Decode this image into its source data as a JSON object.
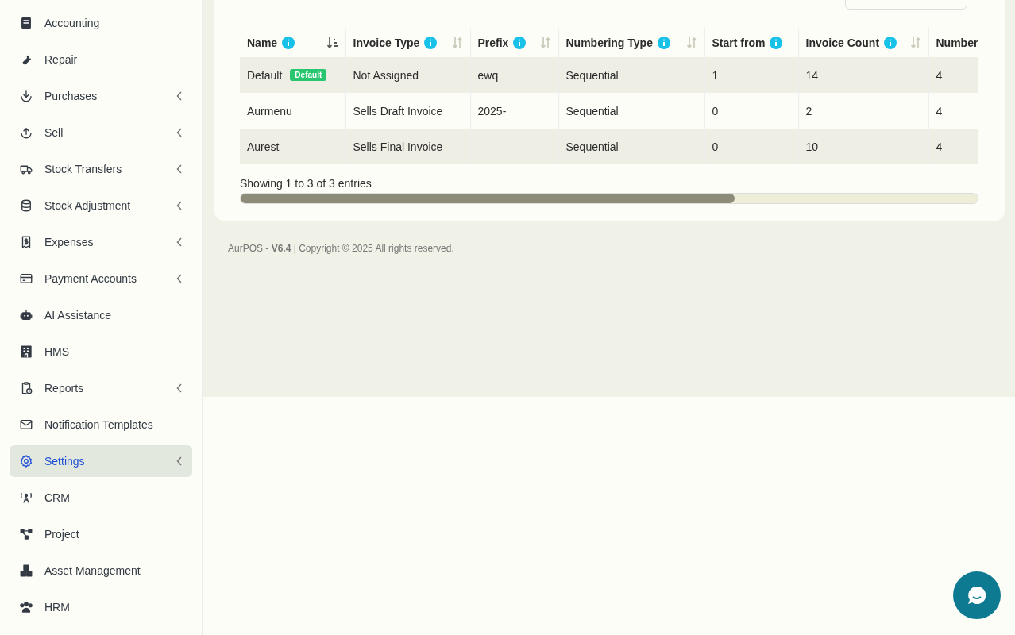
{
  "sidebar": {
    "items": [
      {
        "label": "Accounting",
        "submenu": false,
        "selected": false
      },
      {
        "label": "Repair",
        "submenu": false,
        "selected": false
      },
      {
        "label": "Purchases",
        "submenu": true,
        "selected": false
      },
      {
        "label": "Sell",
        "submenu": true,
        "selected": false
      },
      {
        "label": "Stock Transfers",
        "submenu": true,
        "selected": false
      },
      {
        "label": "Stock Adjustment",
        "submenu": true,
        "selected": false
      },
      {
        "label": "Expenses",
        "submenu": true,
        "selected": false
      },
      {
        "label": "Payment Accounts",
        "submenu": true,
        "selected": false
      },
      {
        "label": "AI Assistance",
        "submenu": false,
        "selected": false
      },
      {
        "label": "HMS",
        "submenu": false,
        "selected": false
      },
      {
        "label": "Reports",
        "submenu": true,
        "selected": false
      },
      {
        "label": "Notification Templates",
        "submenu": false,
        "selected": false
      },
      {
        "label": "Settings",
        "submenu": true,
        "selected": true
      },
      {
        "label": "CRM",
        "submenu": false,
        "selected": false
      },
      {
        "label": "Project",
        "submenu": false,
        "selected": false
      },
      {
        "label": "Asset Management",
        "submenu": false,
        "selected": false
      },
      {
        "label": "HRM",
        "submenu": false,
        "selected": false
      }
    ]
  },
  "table": {
    "columns": [
      {
        "label": "Name",
        "info": true,
        "sortable": true,
        "sorted": true
      },
      {
        "label": "Invoice Type",
        "info": true,
        "sortable": true,
        "sorted": false
      },
      {
        "label": "Prefix",
        "info": true,
        "sortable": true,
        "sorted": false
      },
      {
        "label": "Numbering Type",
        "info": true,
        "sortable": true,
        "sorted": false
      },
      {
        "label": "Start from",
        "info": true,
        "sortable": false
      },
      {
        "label": "Invoice Count",
        "info": true,
        "sortable": true,
        "sorted": false
      },
      {
        "label": "Number",
        "info": false,
        "sortable": false
      }
    ],
    "rows": [
      {
        "cells": [
          "Default",
          "Not Assigned",
          "ewq",
          "Sequential",
          "1",
          "14",
          "4"
        ],
        "badge": "Default"
      },
      {
        "cells": [
          "Aurmenu",
          "Sells Draft Invoice",
          "2025-",
          "Sequential",
          "0",
          "2",
          "4"
        ]
      },
      {
        "cells": [
          "Aurest",
          "Sells Final Invoice",
          "",
          "Sequential",
          "0",
          "10",
          "4"
        ]
      }
    ],
    "info": "Showing 1 to 3 of 3 entries"
  },
  "footer": "AurPOS - **V6.4** | Copyright © 2025 All rights reserved."
}
